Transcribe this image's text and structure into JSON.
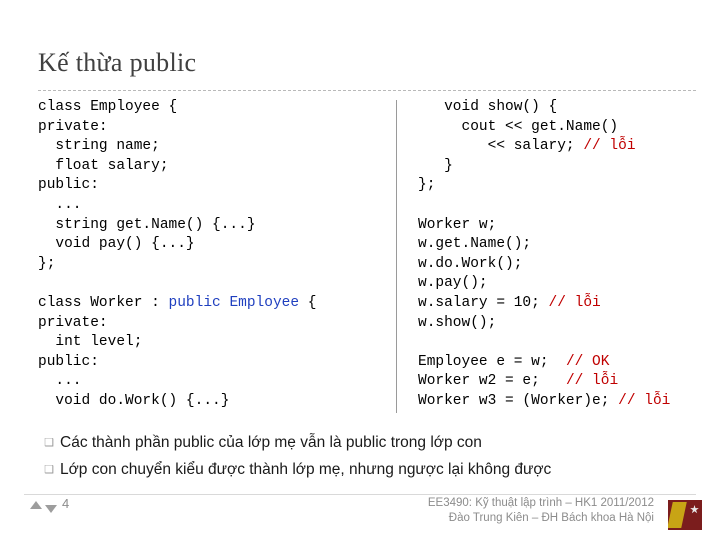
{
  "slide": {
    "title": "Kế thừa public",
    "code_left": [
      {
        "segments": [
          {
            "t": "class Employee {",
            "c": "plain"
          }
        ]
      },
      {
        "segments": [
          {
            "t": "private:",
            "c": "plain"
          }
        ]
      },
      {
        "segments": [
          {
            "t": "  string name;",
            "c": "plain"
          }
        ]
      },
      {
        "segments": [
          {
            "t": "  float salary;",
            "c": "plain"
          }
        ]
      },
      {
        "segments": [
          {
            "t": "public:",
            "c": "plain"
          }
        ]
      },
      {
        "segments": [
          {
            "t": "  ...",
            "c": "plain"
          }
        ]
      },
      {
        "segments": [
          {
            "t": "  string get.Name() {...}",
            "c": "plain"
          }
        ]
      },
      {
        "segments": [
          {
            "t": "  void pay() {...}",
            "c": "plain"
          }
        ]
      },
      {
        "segments": [
          {
            "t": "};",
            "c": "plain"
          }
        ]
      },
      {
        "segments": [
          {
            "t": "",
            "c": "plain"
          }
        ]
      },
      {
        "segments": [
          {
            "t": "class Worker : ",
            "c": "plain"
          },
          {
            "t": "public Employee",
            "c": "kw"
          },
          {
            "t": " {",
            "c": "plain"
          }
        ]
      },
      {
        "segments": [
          {
            "t": "private:",
            "c": "plain"
          }
        ]
      },
      {
        "segments": [
          {
            "t": "  int level;",
            "c": "plain"
          }
        ]
      },
      {
        "segments": [
          {
            "t": "public:",
            "c": "plain"
          }
        ]
      },
      {
        "segments": [
          {
            "t": "  ...",
            "c": "plain"
          }
        ]
      },
      {
        "segments": [
          {
            "t": "  void do.Work() {...}",
            "c": "plain"
          }
        ]
      }
    ],
    "code_right": [
      {
        "segments": [
          {
            "t": "   void show() {",
            "c": "plain"
          }
        ]
      },
      {
        "segments": [
          {
            "t": "     cout << get.Name()",
            "c": "plain"
          }
        ]
      },
      {
        "segments": [
          {
            "t": "        << salary; ",
            "c": "plain"
          },
          {
            "t": "// lỗi",
            "c": "cm"
          }
        ]
      },
      {
        "segments": [
          {
            "t": "   }",
            "c": "plain"
          }
        ]
      },
      {
        "segments": [
          {
            "t": "};",
            "c": "plain"
          }
        ]
      },
      {
        "segments": [
          {
            "t": "",
            "c": "plain"
          }
        ]
      },
      {
        "segments": [
          {
            "t": "Worker w;",
            "c": "plain"
          }
        ]
      },
      {
        "segments": [
          {
            "t": "w.get.Name();",
            "c": "plain"
          }
        ]
      },
      {
        "segments": [
          {
            "t": "w.do.Work();",
            "c": "plain"
          }
        ]
      },
      {
        "segments": [
          {
            "t": "w.pay();",
            "c": "plain"
          }
        ]
      },
      {
        "segments": [
          {
            "t": "w.salary = 10; ",
            "c": "plain"
          },
          {
            "t": "// lỗi",
            "c": "cm"
          }
        ]
      },
      {
        "segments": [
          {
            "t": "w.show();",
            "c": "plain"
          }
        ]
      },
      {
        "segments": [
          {
            "t": "",
            "c": "plain"
          }
        ]
      },
      {
        "segments": [
          {
            "t": "Employee e = w;  ",
            "c": "plain"
          },
          {
            "t": "// OK",
            "c": "cm"
          }
        ]
      },
      {
        "segments": [
          {
            "t": "Worker w2 = e;   ",
            "c": "plain"
          },
          {
            "t": "// lỗi",
            "c": "cm"
          }
        ]
      },
      {
        "segments": [
          {
            "t": "Worker w3 = (Worker)e; ",
            "c": "plain"
          },
          {
            "t": "// lỗi",
            "c": "cm"
          }
        ]
      }
    ],
    "bullets": [
      "Các thành phần public của lớp mẹ vẫn là public trong lớp con",
      "Lớp con chuyển kiểu được thành lớp mẹ, nhưng ngược lại không được"
    ],
    "footer": {
      "slide_number": "4",
      "line1": "EE3490: Kỹ thuật lập trình – HK1 2011/2012",
      "line2": "Đào Trung Kiên – ĐH Bách khoa Hà Nội"
    },
    "colors": {
      "keyword": "#1f3fbf",
      "comment": "#c00000",
      "title": "#404040"
    }
  }
}
